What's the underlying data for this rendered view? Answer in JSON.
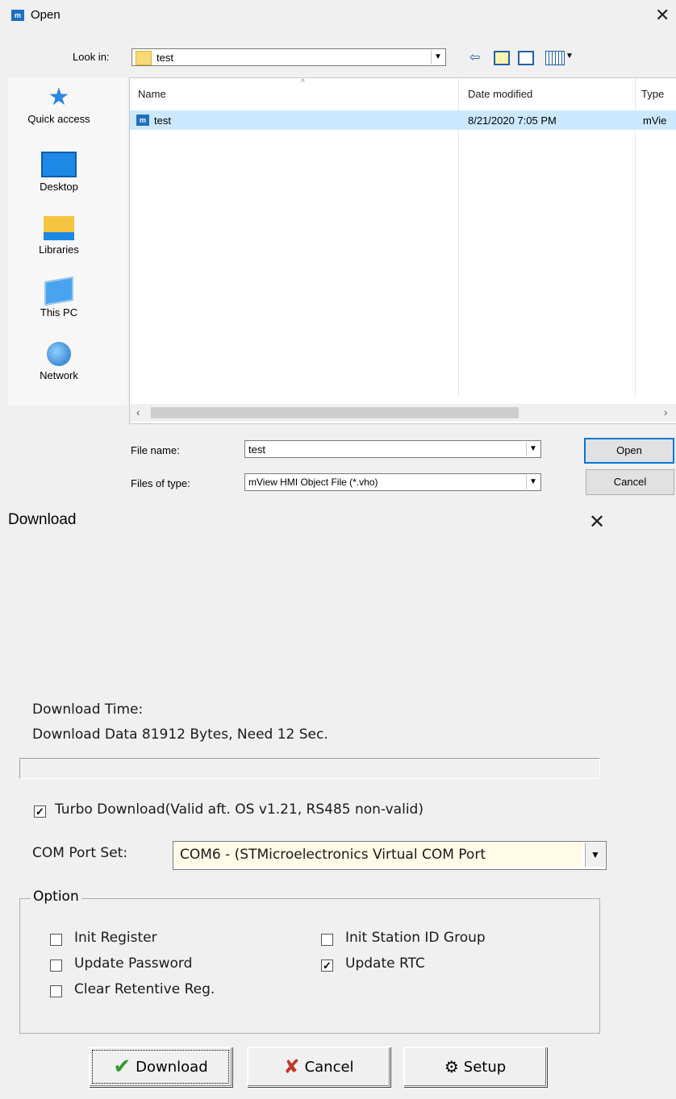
{
  "open_dialog": {
    "app_icon_letter": "m",
    "title": "Open",
    "close_glyph": "✕",
    "look_in_label": "Look in:",
    "look_in_value": "test",
    "toolbar_icons": [
      "back-icon",
      "up-folder-icon",
      "new-folder-icon",
      "view-menu-icon"
    ],
    "places": [
      {
        "label": "Quick access",
        "icon": "star-icon"
      },
      {
        "label": "Desktop",
        "icon": "desktop-icon"
      },
      {
        "label": "Libraries",
        "icon": "libraries-icon"
      },
      {
        "label": "This PC",
        "icon": "computer-icon"
      },
      {
        "label": "Network",
        "icon": "network-icon"
      }
    ],
    "columns": [
      "Name",
      "Date modified",
      "Type"
    ],
    "files": [
      {
        "name": "test",
        "date": "8/21/2020 7:05 PM",
        "type": "mVie"
      }
    ],
    "file_name_label": "File name:",
    "file_name_value": "test",
    "files_of_type_label": "Files of type:",
    "files_of_type_value": "mView HMI Object File (*.vho)",
    "open_button": "Open",
    "cancel_button": "Cancel",
    "selection_color": "#cce8ff"
  },
  "download_dialog": {
    "title": "Download",
    "close_glyph": "✕",
    "download_time_label": "Download Time:",
    "download_info": "Download Data 81912 Bytes, Need 12 Sec.",
    "progress_fraction": 0,
    "turbo_label": "Turbo Download(Valid aft. OS v1.21, RS485 non-valid)",
    "turbo_checked": true,
    "com_port_label": "COM Port Set:",
    "com_port_value": "COM6 - (STMicroelectronics Virtual COM Port",
    "option_legend": "Option",
    "options": [
      {
        "label": "Init Register",
        "checked": false
      },
      {
        "label": "Update Password",
        "checked": false
      },
      {
        "label": "Clear Retentive Reg.",
        "checked": false
      },
      {
        "label": "Init Station ID Group",
        "checked": false
      },
      {
        "label": "Update RTC",
        "checked": true
      }
    ],
    "download_button": "Download",
    "cancel_button": "Cancel",
    "setup_button": "Setup",
    "accent_green": "#2e9b2e",
    "cancel_red": "#c0392b"
  }
}
